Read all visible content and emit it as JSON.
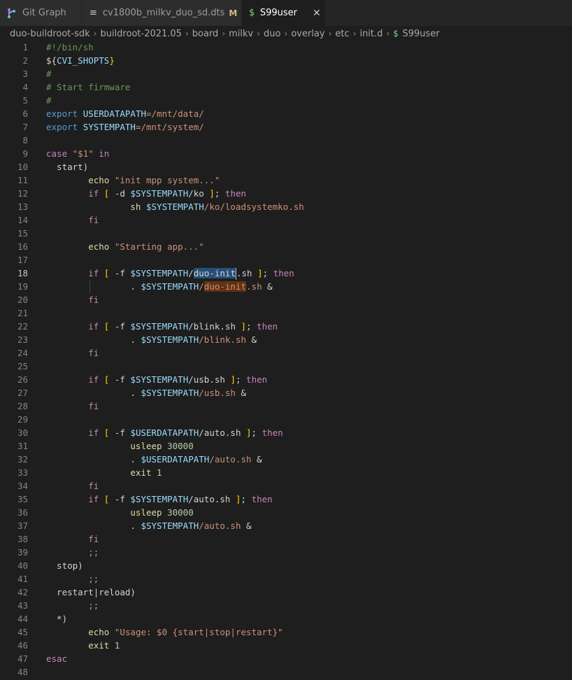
{
  "tabs": [
    {
      "label": "Git Graph",
      "icon": "git-graph-icon",
      "active": false
    },
    {
      "label": "cv1800b_milkv_duo_sd.dts",
      "icon": "lines-icon",
      "badge": "M",
      "active": false
    },
    {
      "label": "S99user",
      "icon": "dollar-icon",
      "active": true
    }
  ],
  "breadcrumb": {
    "items": [
      "duo-buildroot-sdk",
      "buildroot-2021.05",
      "board",
      "milkv",
      "duo",
      "overlay",
      "etc",
      "init.d"
    ],
    "file": "S99user"
  },
  "editor": {
    "current_line": 18,
    "lines": [
      {
        "n": "1",
        "tokens": [
          {
            "t": "#!/bin/sh",
            "c": "com"
          }
        ]
      },
      {
        "n": "2",
        "tokens": [
          {
            "t": "${",
            "c": "plain"
          },
          {
            "t": "CVI_SHOPTS",
            "c": "var"
          },
          {
            "t": "}",
            "c": "brk"
          }
        ]
      },
      {
        "n": "3",
        "tokens": [
          {
            "t": "#",
            "c": "com"
          }
        ]
      },
      {
        "n": "4",
        "tokens": [
          {
            "t": "# Start firmware",
            "c": "com"
          }
        ]
      },
      {
        "n": "5",
        "tokens": [
          {
            "t": "#",
            "c": "com"
          }
        ]
      },
      {
        "n": "6",
        "tokens": [
          {
            "t": "export ",
            "c": "kwb"
          },
          {
            "t": "USERDATAPATH",
            "c": "var"
          },
          {
            "t": "=/mnt/data/",
            "c": "str"
          }
        ]
      },
      {
        "n": "7",
        "tokens": [
          {
            "t": "export ",
            "c": "kwb"
          },
          {
            "t": "SYSTEMPATH",
            "c": "var"
          },
          {
            "t": "=/mnt/system/",
            "c": "str"
          }
        ]
      },
      {
        "n": "8",
        "tokens": []
      },
      {
        "n": "9",
        "tokens": [
          {
            "t": "case ",
            "c": "kw"
          },
          {
            "t": "\"$1\"",
            "c": "str"
          },
          {
            "t": " in",
            "c": "kw"
          }
        ]
      },
      {
        "n": "10",
        "tokens": [
          {
            "t": "  start)",
            "c": "plain"
          }
        ]
      },
      {
        "n": "11",
        "tokens": [
          {
            "t": "        echo ",
            "c": "cmd"
          },
          {
            "t": "\"init mpp system...\"",
            "c": "str"
          }
        ]
      },
      {
        "n": "12",
        "tokens": [
          {
            "t": "        if ",
            "c": "kw"
          },
          {
            "t": "[",
            "c": "brk"
          },
          {
            "t": " -d ",
            "c": "plain"
          },
          {
            "t": "$SYSTEMPATH",
            "c": "var"
          },
          {
            "t": "/ko ",
            "c": "plain"
          },
          {
            "t": "]",
            "c": "brk"
          },
          {
            "t": "; ",
            "c": "plain"
          },
          {
            "t": "then",
            "c": "kw"
          }
        ]
      },
      {
        "n": "13",
        "tokens": [
          {
            "t": "                sh ",
            "c": "cmd"
          },
          {
            "t": "$SYSTEMPATH",
            "c": "var"
          },
          {
            "t": "/ko/loadsystemko.sh",
            "c": "str"
          }
        ]
      },
      {
        "n": "14",
        "tokens": [
          {
            "t": "        fi",
            "c": "kw"
          }
        ]
      },
      {
        "n": "15",
        "tokens": []
      },
      {
        "n": "16",
        "tokens": [
          {
            "t": "        echo ",
            "c": "cmd"
          },
          {
            "t": "\"Starting app...\"",
            "c": "str"
          }
        ]
      },
      {
        "n": "17",
        "tokens": []
      },
      {
        "n": "18",
        "tokens": [
          {
            "t": "        if ",
            "c": "kw"
          },
          {
            "t": "[",
            "c": "brk"
          },
          {
            "t": " -f ",
            "c": "plain"
          },
          {
            "t": "$SYSTEMPATH",
            "c": "var"
          },
          {
            "t": "/",
            "c": "plain"
          },
          {
            "t": "duo-init",
            "c": "plain",
            "sel": true
          },
          {
            "t": "|",
            "c": "cursor"
          },
          {
            "t": ".sh ",
            "c": "plain"
          },
          {
            "t": "]",
            "c": "brk"
          },
          {
            "t": "; ",
            "c": "plain"
          },
          {
            "t": "then",
            "c": "kw"
          }
        ]
      },
      {
        "n": "19",
        "tokens": [
          {
            "t": "                . ",
            "c": "plain"
          },
          {
            "t": "$SYSTEMPATH",
            "c": "var"
          },
          {
            "t": "/",
            "c": "str"
          },
          {
            "t": "duo-init",
            "c": "str",
            "hl": true
          },
          {
            "t": ".sh",
            "c": "str"
          },
          {
            "t": " &",
            "c": "plain"
          }
        ]
      },
      {
        "n": "20",
        "tokens": [
          {
            "t": "        fi",
            "c": "kw"
          }
        ]
      },
      {
        "n": "21",
        "tokens": []
      },
      {
        "n": "22",
        "tokens": [
          {
            "t": "        if ",
            "c": "kw"
          },
          {
            "t": "[",
            "c": "brk"
          },
          {
            "t": " -f ",
            "c": "plain"
          },
          {
            "t": "$SYSTEMPATH",
            "c": "var"
          },
          {
            "t": "/blink.sh ",
            "c": "plain"
          },
          {
            "t": "]",
            "c": "brk"
          },
          {
            "t": "; ",
            "c": "plain"
          },
          {
            "t": "then",
            "c": "kw"
          }
        ]
      },
      {
        "n": "23",
        "tokens": [
          {
            "t": "                . ",
            "c": "plain"
          },
          {
            "t": "$SYSTEMPATH",
            "c": "var"
          },
          {
            "t": "/blink.sh",
            "c": "str"
          },
          {
            "t": " &",
            "c": "plain"
          }
        ]
      },
      {
        "n": "24",
        "tokens": [
          {
            "t": "        fi",
            "c": "kw"
          }
        ]
      },
      {
        "n": "25",
        "tokens": []
      },
      {
        "n": "26",
        "tokens": [
          {
            "t": "        if ",
            "c": "kw"
          },
          {
            "t": "[",
            "c": "brk"
          },
          {
            "t": " -f ",
            "c": "plain"
          },
          {
            "t": "$SYSTEMPATH",
            "c": "var"
          },
          {
            "t": "/usb.sh ",
            "c": "plain"
          },
          {
            "t": "]",
            "c": "brk"
          },
          {
            "t": "; ",
            "c": "plain"
          },
          {
            "t": "then",
            "c": "kw"
          }
        ]
      },
      {
        "n": "27",
        "tokens": [
          {
            "t": "                . ",
            "c": "plain"
          },
          {
            "t": "$SYSTEMPATH",
            "c": "var"
          },
          {
            "t": "/usb.sh",
            "c": "str"
          },
          {
            "t": " &",
            "c": "plain"
          }
        ]
      },
      {
        "n": "28",
        "tokens": [
          {
            "t": "        fi",
            "c": "kw"
          }
        ]
      },
      {
        "n": "29",
        "tokens": []
      },
      {
        "n": "30",
        "tokens": [
          {
            "t": "        if ",
            "c": "kw"
          },
          {
            "t": "[",
            "c": "brk"
          },
          {
            "t": " -f ",
            "c": "plain"
          },
          {
            "t": "$USERDATAPATH",
            "c": "var"
          },
          {
            "t": "/auto.sh ",
            "c": "plain"
          },
          {
            "t": "]",
            "c": "brk"
          },
          {
            "t": "; ",
            "c": "plain"
          },
          {
            "t": "then",
            "c": "kw"
          }
        ]
      },
      {
        "n": "31",
        "tokens": [
          {
            "t": "                usleep ",
            "c": "cmd"
          },
          {
            "t": "30000",
            "c": "num"
          }
        ]
      },
      {
        "n": "32",
        "tokens": [
          {
            "t": "                . ",
            "c": "plain"
          },
          {
            "t": "$USERDATAPATH",
            "c": "var"
          },
          {
            "t": "/auto.sh",
            "c": "str"
          },
          {
            "t": " &",
            "c": "plain"
          }
        ]
      },
      {
        "n": "33",
        "tokens": [
          {
            "t": "                exit ",
            "c": "cmd"
          },
          {
            "t": "1",
            "c": "num"
          }
        ]
      },
      {
        "n": "34",
        "tokens": [
          {
            "t": "        fi",
            "c": "kw"
          }
        ]
      },
      {
        "n": "35",
        "tokens": [
          {
            "t": "        if ",
            "c": "kw"
          },
          {
            "t": "[",
            "c": "brk"
          },
          {
            "t": " -f ",
            "c": "plain"
          },
          {
            "t": "$SYSTEMPATH",
            "c": "var"
          },
          {
            "t": "/auto.sh ",
            "c": "plain"
          },
          {
            "t": "]",
            "c": "brk"
          },
          {
            "t": "; ",
            "c": "plain"
          },
          {
            "t": "then",
            "c": "kw"
          }
        ]
      },
      {
        "n": "36",
        "tokens": [
          {
            "t": "                usleep ",
            "c": "cmd"
          },
          {
            "t": "30000",
            "c": "num"
          }
        ]
      },
      {
        "n": "37",
        "tokens": [
          {
            "t": "                . ",
            "c": "plain"
          },
          {
            "t": "$SYSTEMPATH",
            "c": "var"
          },
          {
            "t": "/auto.sh",
            "c": "str"
          },
          {
            "t": " &",
            "c": "plain"
          }
        ]
      },
      {
        "n": "38",
        "tokens": [
          {
            "t": "        fi",
            "c": "kw"
          }
        ]
      },
      {
        "n": "39",
        "tokens": [
          {
            "t": "        ;;",
            "c": "kw"
          }
        ]
      },
      {
        "n": "40",
        "tokens": [
          {
            "t": "  stop)",
            "c": "plain"
          }
        ]
      },
      {
        "n": "41",
        "tokens": [
          {
            "t": "        ;;",
            "c": "kw"
          }
        ]
      },
      {
        "n": "42",
        "tokens": [
          {
            "t": "  restart|reload)",
            "c": "plain"
          }
        ]
      },
      {
        "n": "43",
        "tokens": [
          {
            "t": "        ;;",
            "c": "kw"
          }
        ]
      },
      {
        "n": "44",
        "tokens": [
          {
            "t": "  *)",
            "c": "plain"
          }
        ]
      },
      {
        "n": "45",
        "tokens": [
          {
            "t": "        echo ",
            "c": "cmd"
          },
          {
            "t": "\"Usage: $0 {start|stop|restart}\"",
            "c": "str"
          }
        ]
      },
      {
        "n": "46",
        "tokens": [
          {
            "t": "        exit ",
            "c": "cmd"
          },
          {
            "t": "1",
            "c": "num"
          }
        ]
      },
      {
        "n": "47",
        "tokens": [
          {
            "t": "esac",
            "c": "kw"
          }
        ]
      },
      {
        "n": "48",
        "tokens": []
      }
    ]
  }
}
